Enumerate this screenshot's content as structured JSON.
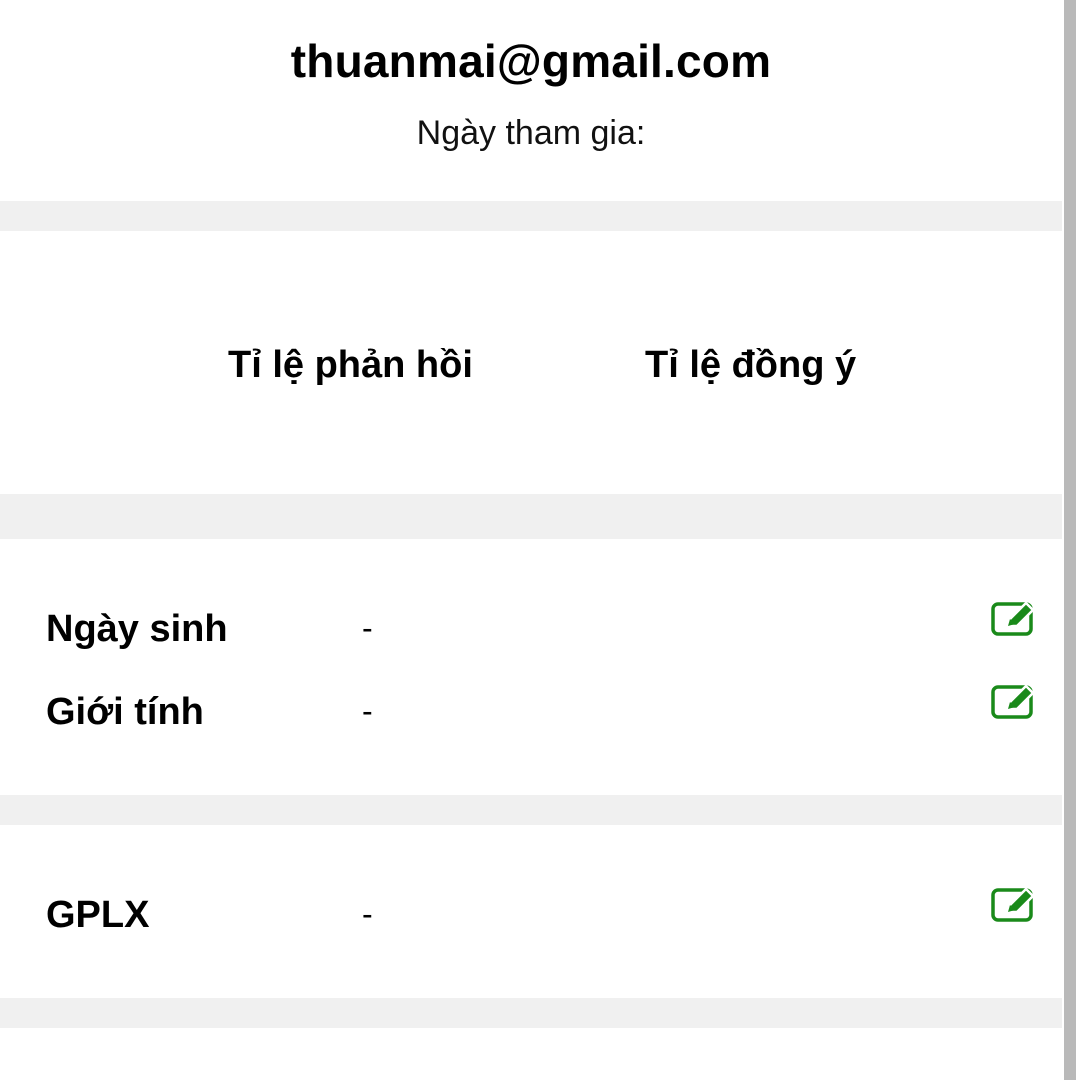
{
  "profile": {
    "email": "thuanmai@gmail.com",
    "join_date_label": "Ngày tham gia:"
  },
  "stats": {
    "response_rate_label": "Tỉ lệ phản hồi",
    "acceptance_rate_label": "Tỉ lệ đồng ý"
  },
  "personal_info": {
    "birthday": {
      "label": "Ngày sinh",
      "value": "-"
    },
    "gender": {
      "label": "Giới tính",
      "value": "-"
    }
  },
  "license": {
    "gplx": {
      "label": "GPLX",
      "value": "-"
    }
  },
  "icons": {
    "edit": "edit-icon"
  },
  "colors": {
    "edit_icon": "#1a8a1a",
    "divider": "#f0f0f0",
    "scrollbar": "#b9b9b9"
  }
}
